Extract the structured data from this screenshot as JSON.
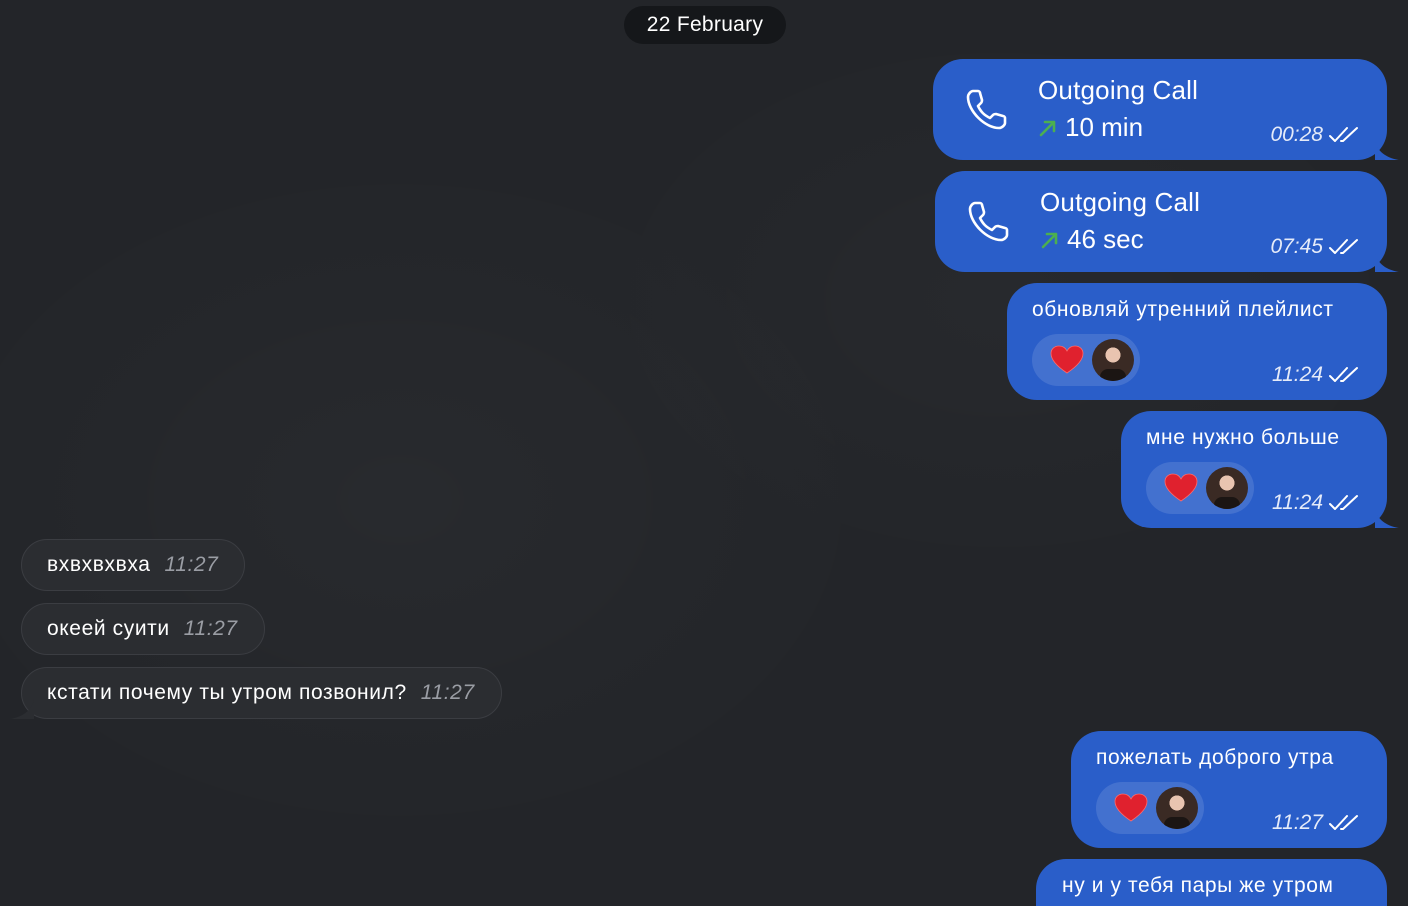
{
  "date_separator": "22 February",
  "calls": [
    {
      "title": "Outgoing Call",
      "duration": "10 min",
      "time": "00:28"
    },
    {
      "title": "Outgoing Call",
      "duration": "46 sec",
      "time": "07:45"
    }
  ],
  "outgoing": [
    {
      "text": "обновляй утренний плейлист",
      "time": "11:24",
      "reaction": "heart"
    },
    {
      "text": "мне нужно больше",
      "time": "11:24",
      "reaction": "heart"
    },
    {
      "text": "пожелать доброго утра",
      "time": "11:27",
      "reaction": "heart"
    },
    {
      "text": "ну и у тебя пары же утром"
    }
  ],
  "incoming": [
    {
      "text": "вхвхвхвха",
      "time": "11:27"
    },
    {
      "text": "океей суити",
      "time": "11:27"
    },
    {
      "text": "кстати почему ты утром позвонил?",
      "time": "11:27"
    }
  ],
  "colors": {
    "background": "#232529",
    "outgoing_bubble": "#2a5ec9",
    "incoming_bubble": "#2b2d31",
    "call_arrow": "#4caf50",
    "heart": "#e0212e"
  },
  "icons": {
    "call": "phone-icon",
    "direction": "arrow-up-right-icon",
    "status": "double-check-icon",
    "reaction": "heart-icon"
  }
}
